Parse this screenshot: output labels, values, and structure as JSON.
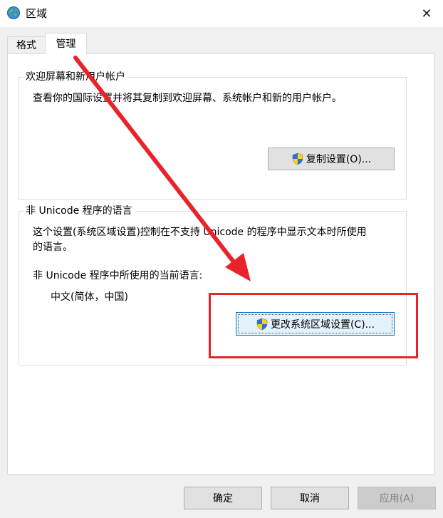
{
  "window": {
    "title": "区域",
    "icon": "globe-icon",
    "close_glyph": "✕"
  },
  "tabs": [
    {
      "label": "格式",
      "selected": false
    },
    {
      "label": "管理",
      "selected": true
    }
  ],
  "welcome_group": {
    "legend": "欢迎屏幕和新用户帐户",
    "description": "查看你的国际设置并将其复制到欢迎屏幕、系统帐户和新的用户帐户。",
    "button_label": "复制设置(O)..."
  },
  "unicode_group": {
    "legend": "非 Unicode 程序的语言",
    "description_line1": "这个设置(系统区域设置)控制在不支持 Unicode 的程序中显示文本时所使用",
    "description_line2": "的语言。",
    "current_label": "非 Unicode 程序中所使用的当前语言:",
    "current_value": "中文(简体，中国)",
    "button_label": "更改系统区域设置(C)..."
  },
  "footer": {
    "ok_label": "确定",
    "cancel_label": "取消",
    "apply_label": "应用(A)"
  },
  "annotation": {
    "color": "#e8232a"
  }
}
